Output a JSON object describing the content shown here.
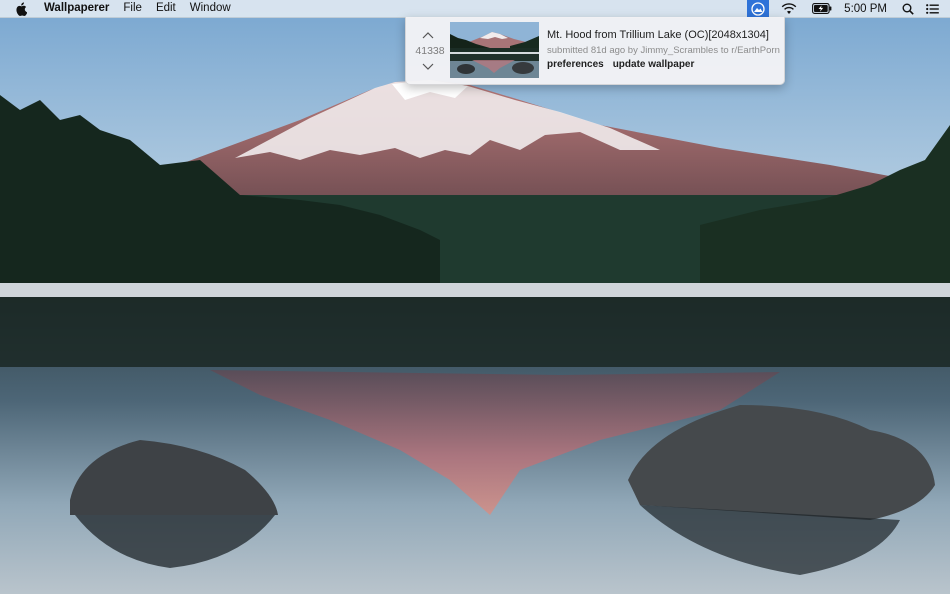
{
  "menubar": {
    "app_name": "Wallpaperer",
    "menus": [
      "File",
      "Edit",
      "Window"
    ],
    "clock": "5:00 PM",
    "status_icons": [
      "wallpaperer-status-icon",
      "wifi-icon",
      "battery-charging-icon",
      "spotlight-search-icon",
      "notification-center-icon"
    ],
    "active_status_color": "#2f73d8"
  },
  "panel": {
    "score": "41338",
    "title": "Mt. Hood from Trillium Lake (OC)[2048x1304]",
    "meta": "submitted 81d ago by Jimmy_Scrambles to r/EarthPorn",
    "actions": {
      "preferences": "preferences",
      "update": "update wallpaper"
    }
  }
}
